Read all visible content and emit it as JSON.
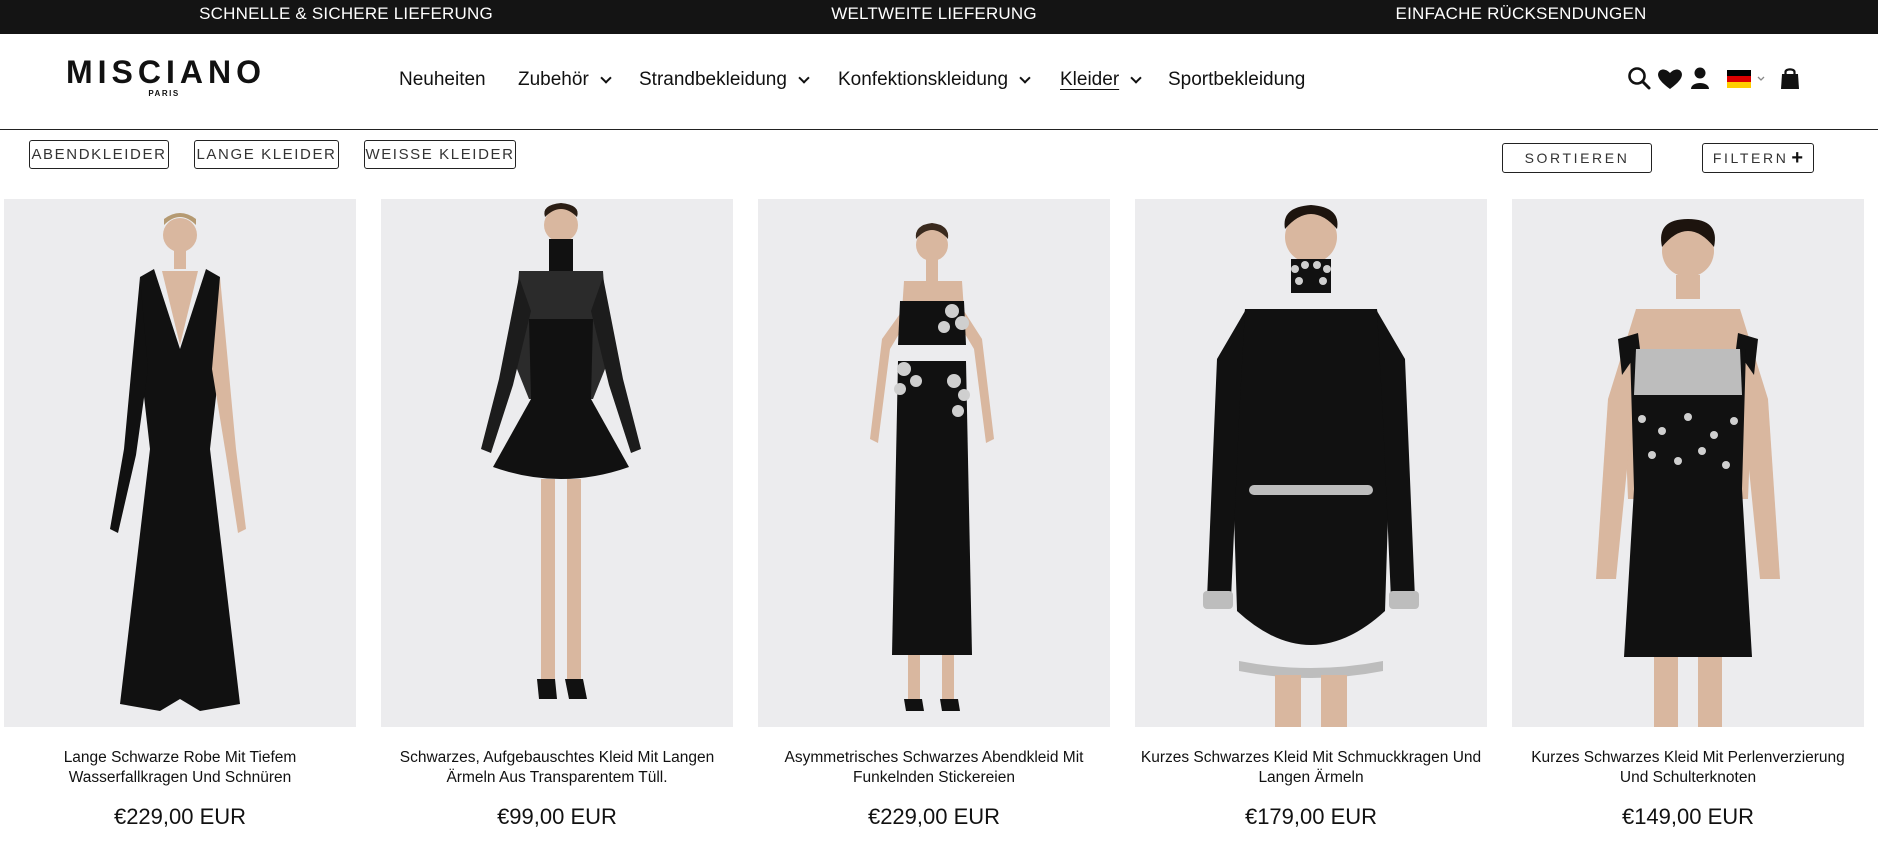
{
  "announcement": [
    "SCHNELLE & SICHERE LIEFERUNG",
    "WELTWEITE LIEFERUNG",
    "EINFACHE RÜCKSENDUNGEN"
  ],
  "brand": {
    "name": "MISCIANO",
    "sub": "PARIS"
  },
  "nav": [
    {
      "label": "Neuheiten",
      "dropdown": false
    },
    {
      "label": "Zubehör",
      "dropdown": true
    },
    {
      "label": "Strandbekleidung",
      "dropdown": true
    },
    {
      "label": "Konfektionskleidung",
      "dropdown": true
    },
    {
      "label": "Kleider",
      "dropdown": true,
      "active": true
    },
    {
      "label": "Sportbekleidung",
      "dropdown": false
    }
  ],
  "header_icons": [
    "search-icon",
    "heart-icon",
    "account-icon",
    "german-flag-icon",
    "shopping-bag-icon"
  ],
  "filters": {
    "tags": [
      "ABENDKLEIDER",
      "LANGE KLEIDER",
      "WEISSE KLEIDER"
    ],
    "sort_label": "SORTIEREN",
    "filter_label": "FILTERN"
  },
  "products": [
    {
      "title": "Lange Schwarze Robe Mit Tiefem Wasserfallkragen Und Schnüren",
      "price": "€229,00 EUR"
    },
    {
      "title": "Schwarzes, Aufgebauschtes Kleid Mit Langen Ärmeln Aus Transparentem Tüll.",
      "price": "€99,00 EUR"
    },
    {
      "title": "Asymmetrisches Schwarzes Abendkleid Mit Funkelnden Stickereien",
      "price": "€229,00 EUR"
    },
    {
      "title": "Kurzes Schwarzes Kleid Mit Schmuckkragen Und Langen Ärmeln",
      "price": "€179,00 EUR"
    },
    {
      "title": "Kurzes Schwarzes Kleid Mit Perlenverzierung Und Schulterknoten",
      "price": "€149,00 EUR"
    }
  ],
  "colors": {
    "announcement_bg": "#141414",
    "photo_bg": "#ececee",
    "dress": "#111111",
    "skin": "#d9b79f"
  }
}
